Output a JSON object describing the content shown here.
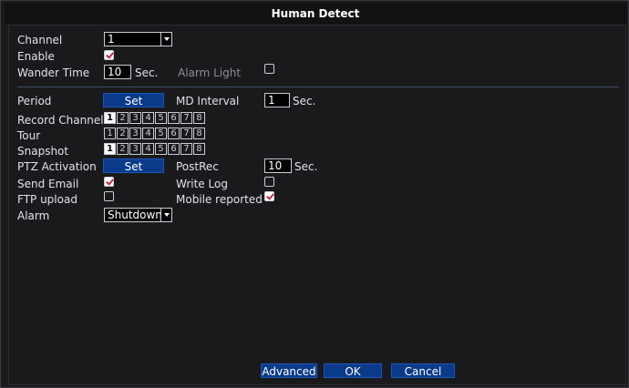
{
  "dialog": {
    "title": "Human Detect"
  },
  "labels": {
    "channel": "Channel",
    "enable": "Enable",
    "wander_time": "Wander Time",
    "alarm_light": "Alarm Light",
    "period": "Period",
    "md_interval": "MD Interval",
    "record_channel": "Record Channel",
    "tour": "Tour",
    "snapshot": "Snapshot",
    "ptz_activation": "PTZ Activation",
    "postrec": "PostRec",
    "send_email": "Send Email",
    "write_log": "Write Log",
    "ftp_upload": "FTP upload",
    "mobile_reported": "Mobile reported",
    "alarm": "Alarm",
    "sec": "Sec."
  },
  "values": {
    "channel": "1",
    "wander_time": "10",
    "md_interval": "1",
    "postrec": "10",
    "alarm": "Shutdown"
  },
  "checkboxes": {
    "enable": true,
    "alarm_light": false,
    "send_email": true,
    "write_log": false,
    "ftp_upload": false,
    "mobile_reported": true
  },
  "channels": [
    "1",
    "2",
    "3",
    "4",
    "5",
    "6",
    "7",
    "8"
  ],
  "record_channel_selected": [
    "1"
  ],
  "tour_selected": [],
  "snapshot_selected": [
    "1"
  ],
  "buttons": {
    "period_set": "Set",
    "ptz_set": "Set",
    "advanced": "Advanced",
    "ok": "OK",
    "cancel": "Cancel"
  }
}
